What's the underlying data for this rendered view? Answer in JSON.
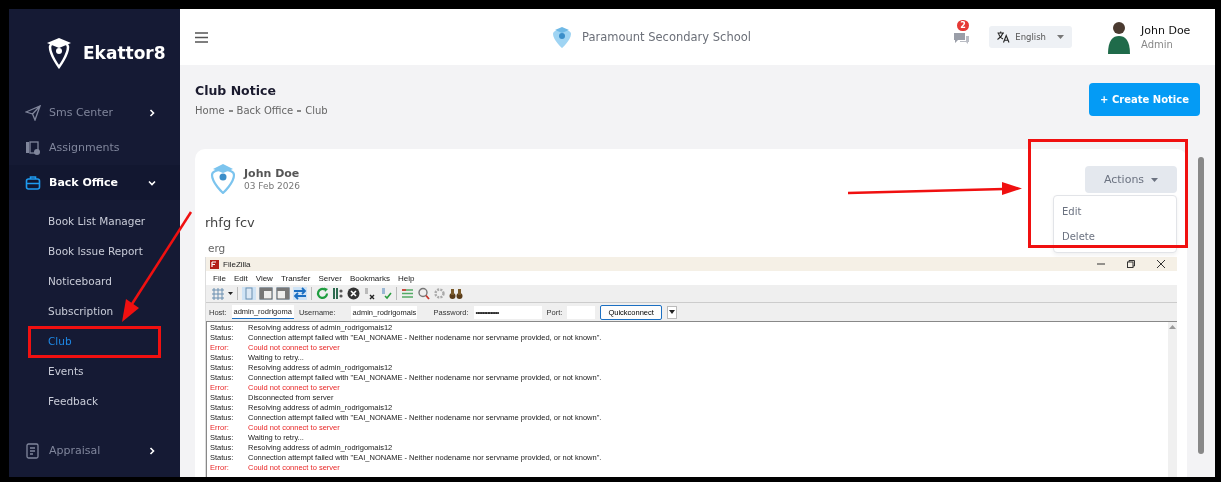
{
  "sidebar": {
    "brand": "Ekattor8",
    "items": [
      {
        "label": "Sms Center",
        "kind": "group",
        "expanded": false
      },
      {
        "label": "Assignments",
        "kind": "link"
      },
      {
        "label": "Back Office",
        "kind": "group",
        "expanded": true,
        "children": [
          {
            "label": "Book List Manager",
            "selected": false
          },
          {
            "label": "Book Issue Report",
            "selected": false
          },
          {
            "label": "Noticeboard",
            "selected": false
          },
          {
            "label": "Subscription",
            "selected": false
          },
          {
            "label": "Club",
            "selected": true
          },
          {
            "label": "Events",
            "selected": false
          },
          {
            "label": "Feedback",
            "selected": false
          }
        ]
      },
      {
        "label": "Appraisal",
        "kind": "group",
        "expanded": false
      }
    ]
  },
  "header": {
    "school_name": "Paramount Secondary School",
    "messages_badge": "2",
    "language": "English",
    "user": {
      "name": "John Doe",
      "role": "Admin"
    }
  },
  "page": {
    "title": "Club Notice",
    "breadcrumbs": [
      "Home",
      "Back Office",
      "Club"
    ],
    "create_button": "+ Create Notice"
  },
  "notice": {
    "author": "John Doe",
    "date": "03 Feb 2026",
    "title": "rhfg fcv",
    "body": "erg",
    "actions_button": "Actions",
    "actions_menu": {
      "expanded": true,
      "items": [
        "Edit",
        "Delete"
      ]
    },
    "attachment": {
      "title": "FileZilla",
      "menu": [
        "File",
        "Edit",
        "View",
        "Transfer",
        "Server",
        "Bookmarks",
        "Help"
      ],
      "quickconnect": {
        "host_label": "Host:",
        "host": "admin_rodrigoma",
        "username_label": "Username:",
        "username": "admin_rodrigomais",
        "password_label": "Password:",
        "password": "••••••••••••••",
        "port_label": "Port:",
        "button": "Quickconnect"
      },
      "log": [
        {
          "kind": "status",
          "label": "Status:",
          "message": "Resolving address of admin_rodrigomais12"
        },
        {
          "kind": "status",
          "label": "Status:",
          "message": "Connection attempt failed with \"EAI_NONAME - Neither nodename nor servname provided, or not known\"."
        },
        {
          "kind": "error",
          "label": "Error:",
          "message": "Could not connect to server"
        },
        {
          "kind": "status",
          "label": "Status:",
          "message": "Waiting to retry..."
        },
        {
          "kind": "status",
          "label": "Status:",
          "message": "Resolving address of admin_rodrigomais12"
        },
        {
          "kind": "status",
          "label": "Status:",
          "message": "Connection attempt failed with \"EAI_NONAME - Neither nodename nor servname provided, or not known\"."
        },
        {
          "kind": "error",
          "label": "Error:",
          "message": "Could not connect to server"
        },
        {
          "kind": "status",
          "label": "Status:",
          "message": "Disconnected from server"
        },
        {
          "kind": "status",
          "label": "Status:",
          "message": "Resolving address of admin_rodrigomais12"
        },
        {
          "kind": "status",
          "label": "Status:",
          "message": "Connection attempt failed with \"EAI_NONAME - Neither nodename nor servname provided, or not known\"."
        },
        {
          "kind": "error",
          "label": "Error:",
          "message": "Could not connect to server"
        },
        {
          "kind": "status",
          "label": "Status:",
          "message": "Waiting to retry..."
        },
        {
          "kind": "status",
          "label": "Status:",
          "message": "Resolving address of admin_rodrigomais12"
        },
        {
          "kind": "status",
          "label": "Status:",
          "message": "Connection attempt failed with \"EAI_NONAME - Neither nodename nor servname provided, or not known\"."
        },
        {
          "kind": "error",
          "label": "Error:",
          "message": "Could not connect to server"
        }
      ]
    }
  }
}
